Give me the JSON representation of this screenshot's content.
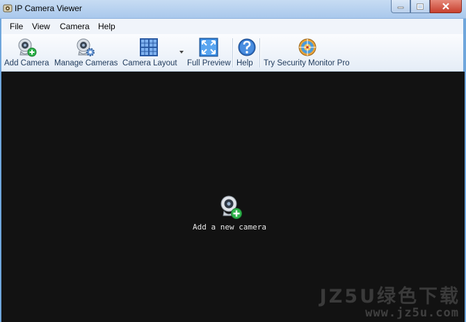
{
  "window": {
    "title": "IP Camera Viewer"
  },
  "menu": {
    "items": [
      "File",
      "View",
      "Camera",
      "Help"
    ]
  },
  "toolbar": {
    "buttons": [
      {
        "label": "Add Camera",
        "icon": "webcam-add-icon"
      },
      {
        "label": "Manage Cameras",
        "icon": "webcam-gear-icon"
      },
      {
        "label": "Camera Layout",
        "icon": "grid-layout-icon"
      },
      {
        "label": "Full Preview",
        "icon": "fullscreen-icon"
      },
      {
        "label": "Help",
        "icon": "help-icon"
      },
      {
        "label": "Try Security Monitor Pro",
        "icon": "security-monitor-icon"
      }
    ]
  },
  "viewport": {
    "center_label": "Add a new camera"
  },
  "watermark": {
    "main": "JZ5U绿色下载",
    "sub": "www.jz5u.com"
  },
  "colors": {
    "viewport_bg": "#121212",
    "accent": "#6fa6dc",
    "add_green": "#2db34a"
  }
}
